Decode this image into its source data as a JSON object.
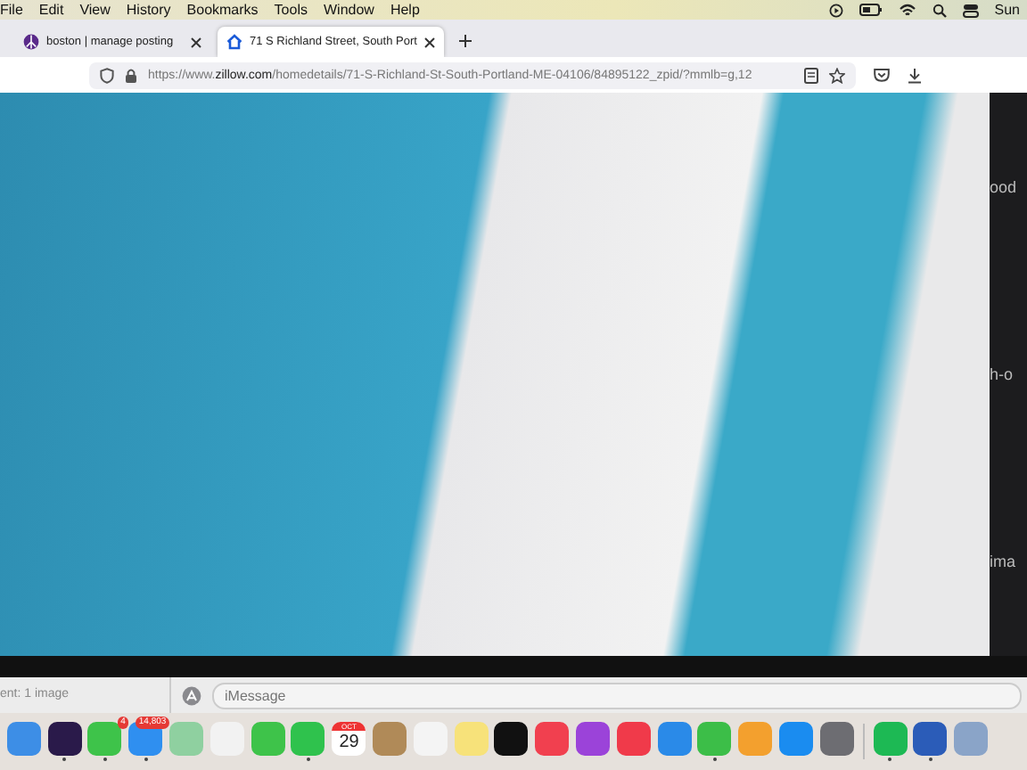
{
  "menu_bar": {
    "items": [
      "File",
      "Edit",
      "View",
      "History",
      "Bookmarks",
      "Tools",
      "Window",
      "Help"
    ],
    "clock": "Sun"
  },
  "tabs": [
    {
      "title": "boston | manage posting",
      "selected": false
    },
    {
      "title": "71 S Richland Street, South Port",
      "selected": true
    }
  ],
  "address_bar": {
    "url_prefix": "https://www.",
    "url_domain": "zillow.com",
    "url_path": "/homedetails/71-S-Richland-St-South-Portland-ME-04106/84895122_zpid/?mmlb=g,12"
  },
  "side_panel_fragments": [
    "ood",
    "h-o",
    "ima"
  ],
  "messages": {
    "caption": "ent: 1 image",
    "placeholder": "iMessage"
  },
  "dock": [
    {
      "kind": "app",
      "color": "#3d8ee6",
      "running": false
    },
    {
      "kind": "app",
      "color": "#2a1a4a",
      "running": true
    },
    {
      "kind": "app",
      "color": "#3ec34a",
      "running": true,
      "badge": "4"
    },
    {
      "kind": "app",
      "color": "#2f8ff0",
      "running": true,
      "badge": "14,803"
    },
    {
      "kind": "app",
      "color": "#8fd0a0",
      "running": false
    },
    {
      "kind": "app",
      "color": "#f2f2f2",
      "running": false
    },
    {
      "kind": "app",
      "color": "#3ec34a",
      "running": false
    },
    {
      "kind": "app",
      "color": "#2fc24d",
      "running": true
    },
    {
      "kind": "calendar",
      "month": "OCT",
      "day": "29",
      "running": false
    },
    {
      "kind": "app",
      "color": "#b08a58",
      "running": false
    },
    {
      "kind": "app",
      "color": "#f4f4f4",
      "running": false
    },
    {
      "kind": "app",
      "color": "#f7e27a",
      "running": false
    },
    {
      "kind": "app",
      "color": "#111111",
      "running": false
    },
    {
      "kind": "app",
      "color": "#f1404f",
      "running": false
    },
    {
      "kind": "app",
      "color": "#9b43d9",
      "running": false
    },
    {
      "kind": "app",
      "color": "#f03a4a",
      "running": false
    },
    {
      "kind": "app",
      "color": "#2a8ae8",
      "running": false
    },
    {
      "kind": "app",
      "color": "#3cbe48",
      "running": true
    },
    {
      "kind": "app",
      "color": "#f3a02e",
      "running": false
    },
    {
      "kind": "app",
      "color": "#1a8cf0",
      "running": false
    },
    {
      "kind": "app",
      "color": "#6d6d72",
      "running": false
    },
    {
      "kind": "separator"
    },
    {
      "kind": "app",
      "color": "#1db954",
      "running": true
    },
    {
      "kind": "app",
      "color": "#2b5cb8",
      "running": true
    },
    {
      "kind": "app",
      "color": "#8aa4c8",
      "running": false
    }
  ]
}
